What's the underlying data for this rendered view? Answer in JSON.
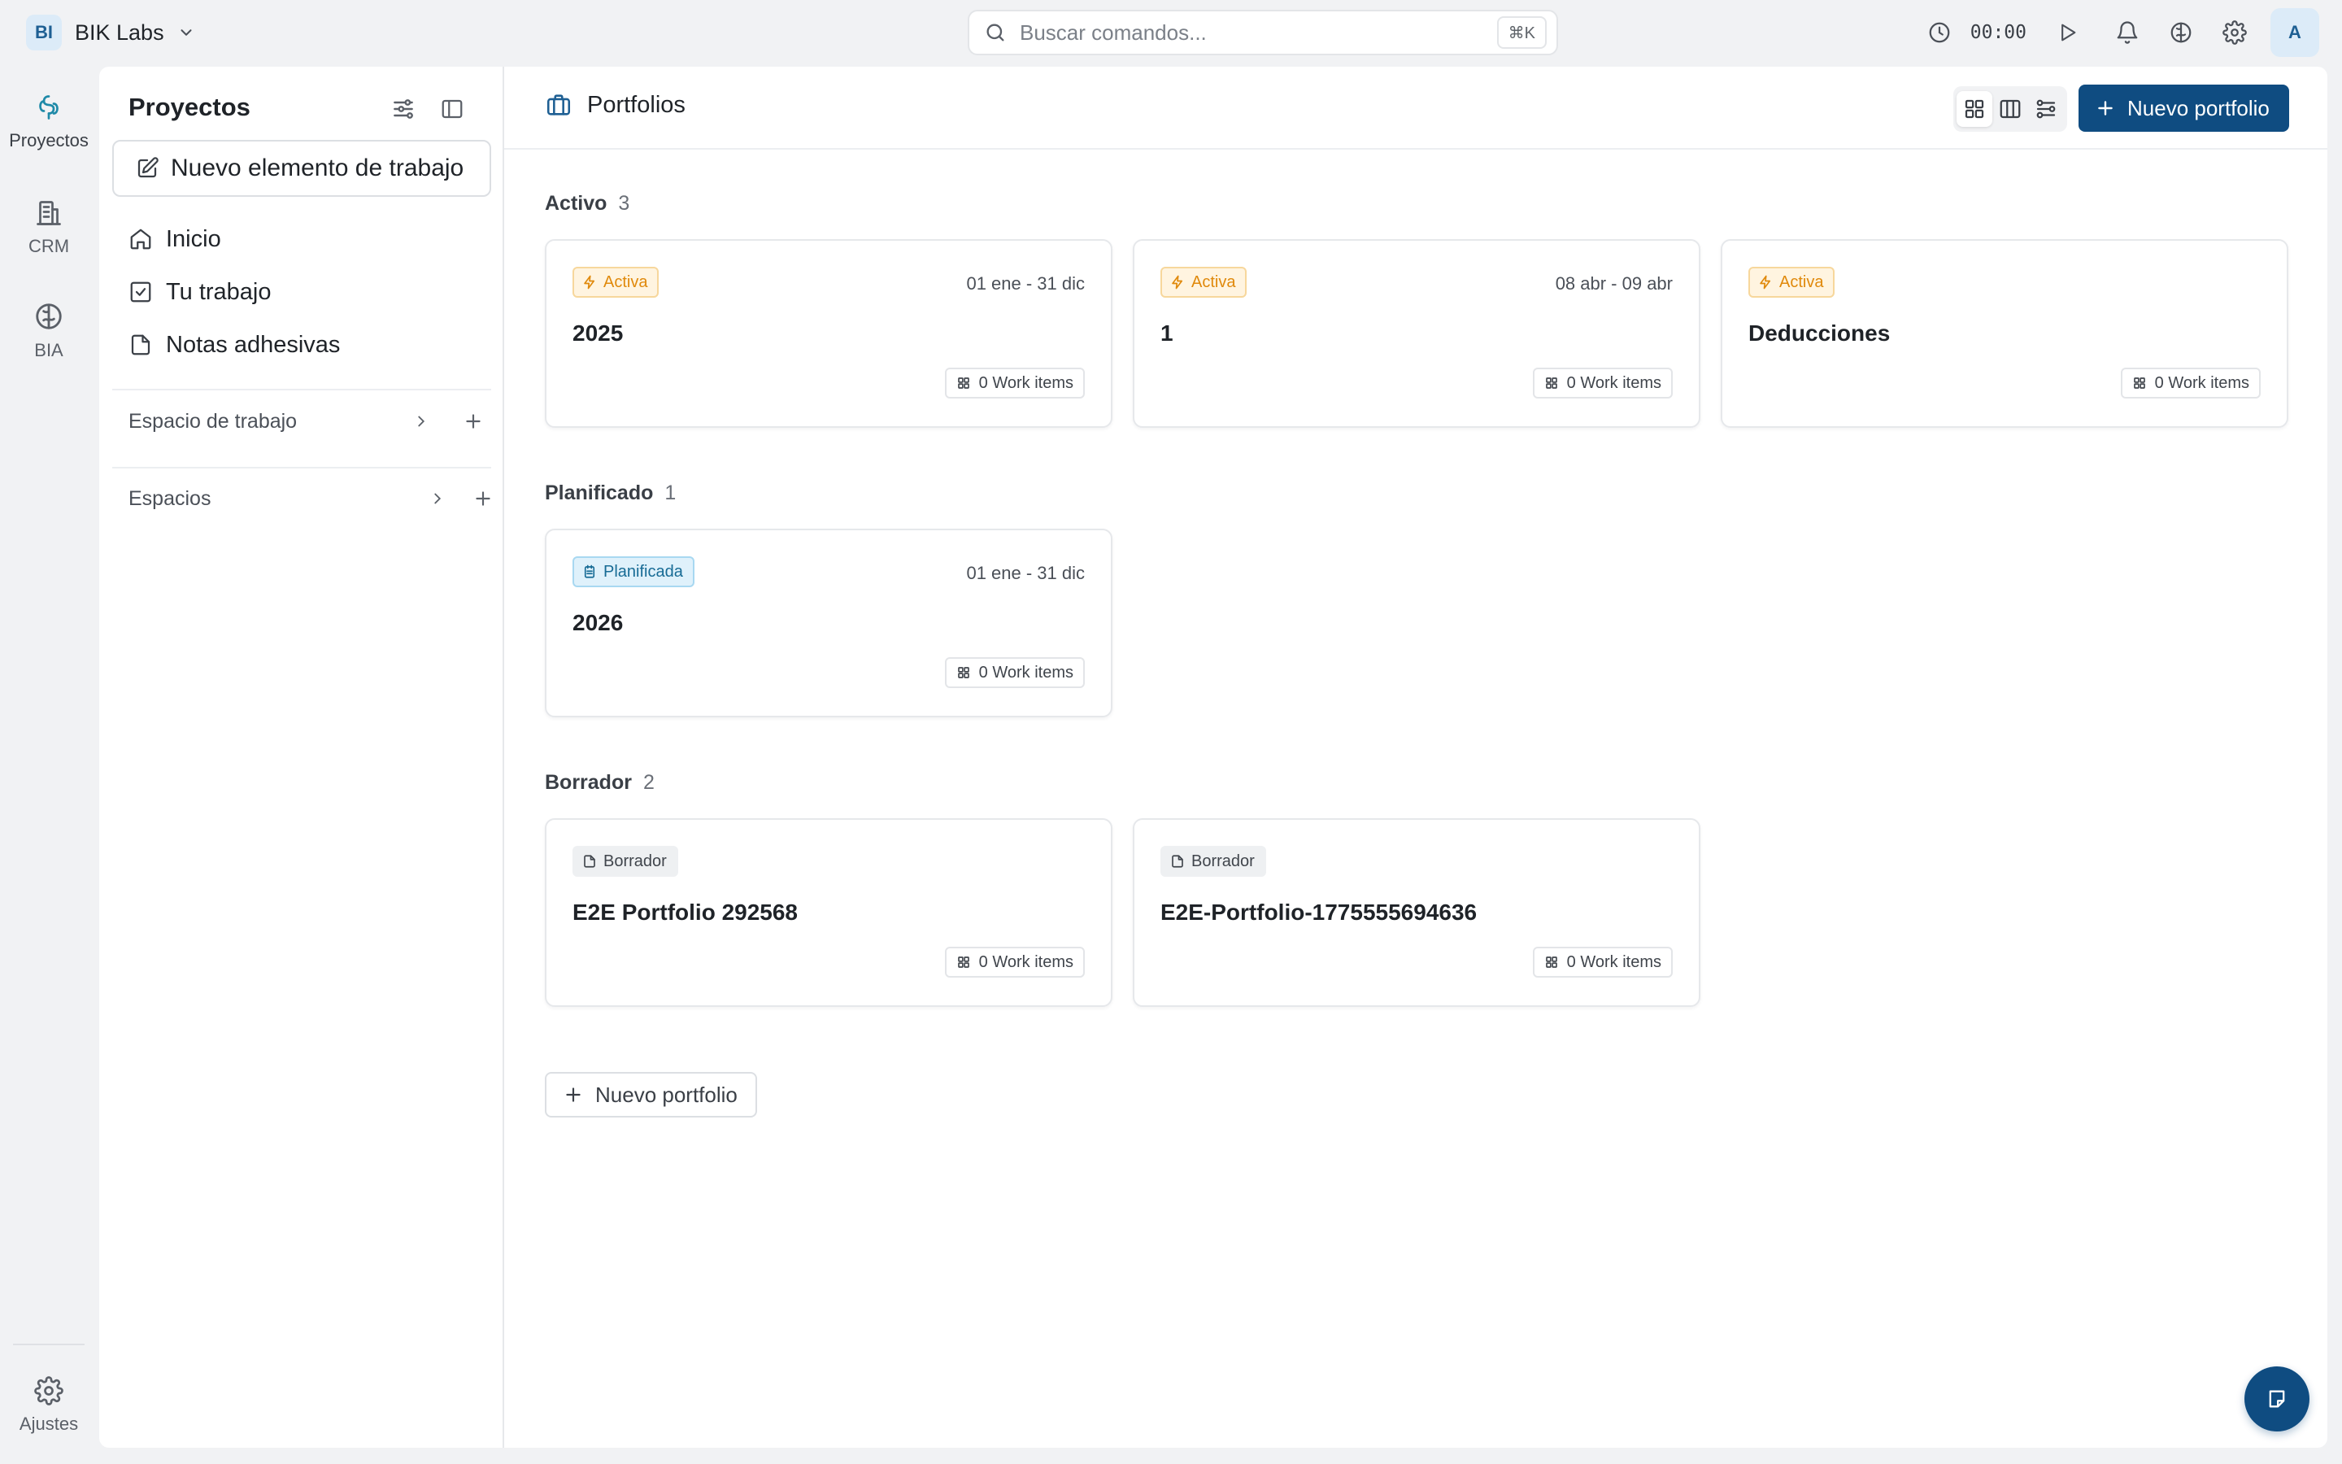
{
  "workspace": {
    "initials": "BI",
    "name": "BIK Labs"
  },
  "search": {
    "placeholder": "Buscar comandos...",
    "shortcut": "⌘K"
  },
  "topbar": {
    "timer": "00:00",
    "avatar_initial": "A"
  },
  "rail": {
    "items": [
      {
        "label": "Proyectos",
        "icon": "projects-icon"
      },
      {
        "label": "CRM",
        "icon": "building-icon"
      },
      {
        "label": "BIA",
        "icon": "brain-icon"
      }
    ],
    "settings_label": "Ajustes"
  },
  "sidebar": {
    "title": "Proyectos",
    "new_item_label": "Nuevo elemento de trabajo",
    "nav": [
      {
        "label": "Inicio",
        "icon": "home-icon"
      },
      {
        "label": "Tu trabajo",
        "icon": "checkbox-icon"
      },
      {
        "label": "Notas adhesivas",
        "icon": "note-icon"
      }
    ],
    "sections": [
      {
        "label": "Espacio de trabajo"
      },
      {
        "label": "Espacios"
      }
    ]
  },
  "main": {
    "title": "Portfolios",
    "new_portfolio_label": "Nuevo portfolio",
    "add_portfolio_label": "Nuevo portfolio",
    "groups": [
      {
        "name": "Activo",
        "count": "3",
        "cards": [
          {
            "status": "Activa",
            "dates": "01 ene - 31 dic",
            "title": "2025",
            "work_items": "0 Work items"
          },
          {
            "status": "Activa",
            "dates": "08 abr - 09 abr",
            "title": "1",
            "work_items": "0 Work items"
          },
          {
            "status": "Activa",
            "dates": "",
            "title": "Deducciones",
            "work_items": "0 Work items"
          }
        ]
      },
      {
        "name": "Planificado",
        "count": "1",
        "cards": [
          {
            "status": "Planificada",
            "dates": "01 ene - 31 dic",
            "title": "2026",
            "work_items": "0 Work items"
          }
        ]
      },
      {
        "name": "Borrador",
        "count": "2",
        "cards": [
          {
            "status": "Borrador",
            "dates": "",
            "title": "E2E Portfolio 292568",
            "work_items": "0 Work items"
          },
          {
            "status": "Borrador",
            "dates": "",
            "title": "E2E-Portfolio-1775555694636",
            "work_items": "0 Work items"
          }
        ]
      }
    ]
  },
  "colors": {
    "primary": "#0f4c81",
    "active": "#e0890b",
    "planned": "#176b95",
    "draft": "#40454c"
  }
}
